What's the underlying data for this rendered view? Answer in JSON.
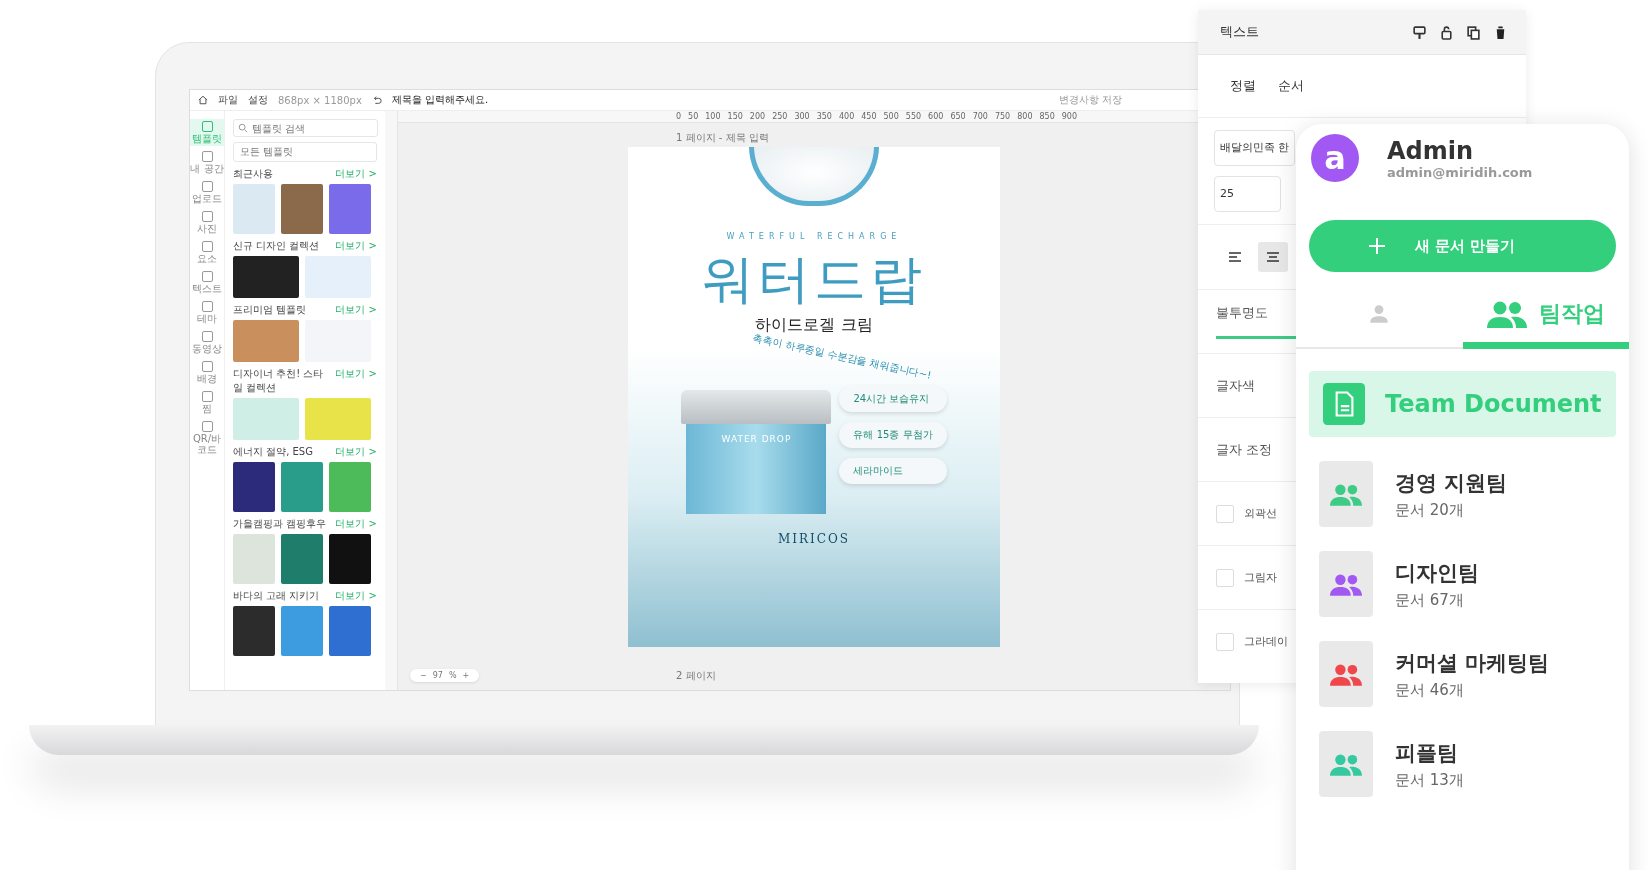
{
  "editor": {
    "toolbar": {
      "menus": [
        "파일",
        "설정"
      ],
      "size": "868px × 1180px",
      "title": "제목을 입력해주세요.",
      "save": "변경사항 저장"
    },
    "rail": [
      {
        "label": "템플릿",
        "selected": true
      },
      {
        "label": "내 공간",
        "selected": false
      },
      {
        "label": "업로드",
        "selected": false
      },
      {
        "label": "사진",
        "selected": false
      },
      {
        "label": "요소",
        "selected": false
      },
      {
        "label": "텍스트",
        "selected": false
      },
      {
        "label": "테마",
        "selected": false
      },
      {
        "label": "동영상",
        "selected": false
      },
      {
        "label": "배경",
        "selected": false
      },
      {
        "label": "찜",
        "selected": false
      },
      {
        "label": "QR/바코드",
        "selected": false
      }
    ],
    "template_panel": {
      "search": {
        "placeholder": "템플릿 검색"
      },
      "filter": "모든 템플릿",
      "sections": [
        {
          "title": "최근사용",
          "more": "더보기 >"
        },
        {
          "title": "신규 디자인 컬렉션",
          "more": "더보기 >"
        },
        {
          "title": "프리미엄 템플릿",
          "more": "더보기 >"
        },
        {
          "title": "디자이너 추천! 스타일 컬렉션",
          "more": "더보기 >"
        },
        {
          "title": "에너지 절약, ESG",
          "more": "더보기 >"
        },
        {
          "title": "가을캠핑과 캠핑후우",
          "more": "더보기 >"
        },
        {
          "title": "바다의 고래 지키기",
          "more": "더보기 >"
        }
      ]
    },
    "ruler_h": [
      "0",
      "50",
      "100",
      "150",
      "200",
      "250",
      "300",
      "350",
      "400",
      "450",
      "500",
      "550",
      "600",
      "650",
      "700",
      "750",
      "800",
      "850",
      "900"
    ],
    "page_label": "1 페이지 - 제목 입력",
    "next_page_label": "2 페이지",
    "zoom": {
      "minus": "−",
      "value": "97",
      "unit": "%",
      "plus": "+"
    },
    "poster": {
      "tagline": "WATERFUL RECHARGE",
      "title": "워터드랍",
      "subtitle": "하이드로겔 크림",
      "curve_text": "촉촉이 하루종일 수분감을 채워줍니다~!",
      "badges": [
        "24시간 보습유지",
        "유해 15종 무첨가",
        "세라마이드"
      ],
      "jar_label": "WATER DROP",
      "brand": "MIRICOS"
    }
  },
  "text_panel": {
    "title": "텍스트",
    "tabs": [
      "정렬",
      "순서"
    ],
    "font": "배달의민족 한",
    "font_size": "25",
    "align": [
      {
        "kind": "left",
        "selected": false
      },
      {
        "kind": "center",
        "selected": true
      }
    ],
    "opacity_label": "불투명도",
    "color_label": "글자색",
    "adjust_label": "글자 조정",
    "options": [
      {
        "label": "외곽선",
        "checked": false
      },
      {
        "label": "그림자",
        "checked": false
      },
      {
        "label": "그라데이",
        "checked": false
      }
    ]
  },
  "account_card": {
    "avatar": "a",
    "name": "Admin",
    "email": "admin@miridih.com",
    "new_button": "새 문서 만들기",
    "tabs": [
      {
        "kind": "personal",
        "selected": false
      },
      {
        "kind": "team",
        "label": "팀작업",
        "selected": true
      }
    ],
    "team_document": {
      "label": "Team Document",
      "selected": true
    },
    "teams": [
      {
        "name": "경영 지원팀",
        "count": "문서 20개",
        "color": "#3ecb86"
      },
      {
        "name": "디자인팀",
        "count": "문서 67개",
        "color": "#a258f2"
      },
      {
        "name": "커머셜 마케팅팀",
        "count": "문서 46개",
        "color": "#f0474c"
      },
      {
        "name": "피플팀",
        "count": "문서 13개",
        "color": "#34c99e"
      }
    ]
  }
}
